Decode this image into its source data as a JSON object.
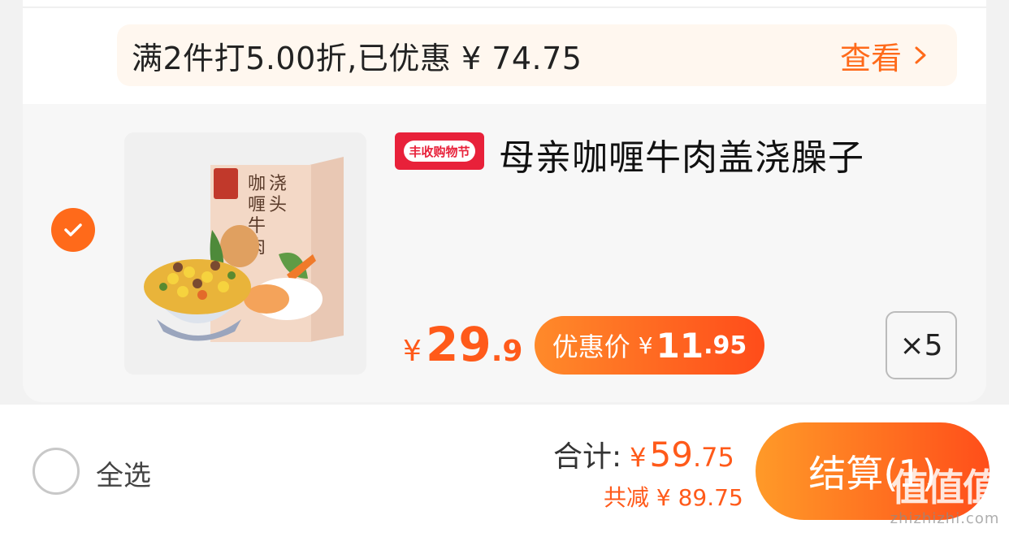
{
  "promo": {
    "text": "满2件打5.00折,已优惠 ¥ 74.75",
    "link_label": "查看"
  },
  "product": {
    "badge": "丰收购物节",
    "title": "母亲咖喱牛肉盖浇臊子",
    "image_icon": "product-image",
    "package_text": "浇头\n咖喱牛肉",
    "price": {
      "currency": "¥",
      "integer": "29",
      "decimal": ".9"
    },
    "discount": {
      "label": "优惠价",
      "currency": "¥",
      "integer": "11",
      "decimal": ".95"
    },
    "quantity": "×5",
    "selected": true
  },
  "footer": {
    "select_all_label": "全选",
    "total_label": "合计:",
    "total_currency": "¥",
    "total_integer": "59",
    "total_decimal": ".75",
    "saved_text": "共减 ¥ 89.75",
    "checkout_label": "结算(1)"
  },
  "watermark": {
    "logo": "值值值",
    "url": "zhizhizhi.com"
  },
  "colors": {
    "accent": "#ff6a1a",
    "badge_red": "#e8213a",
    "promo_bg": "#fff7ef"
  }
}
